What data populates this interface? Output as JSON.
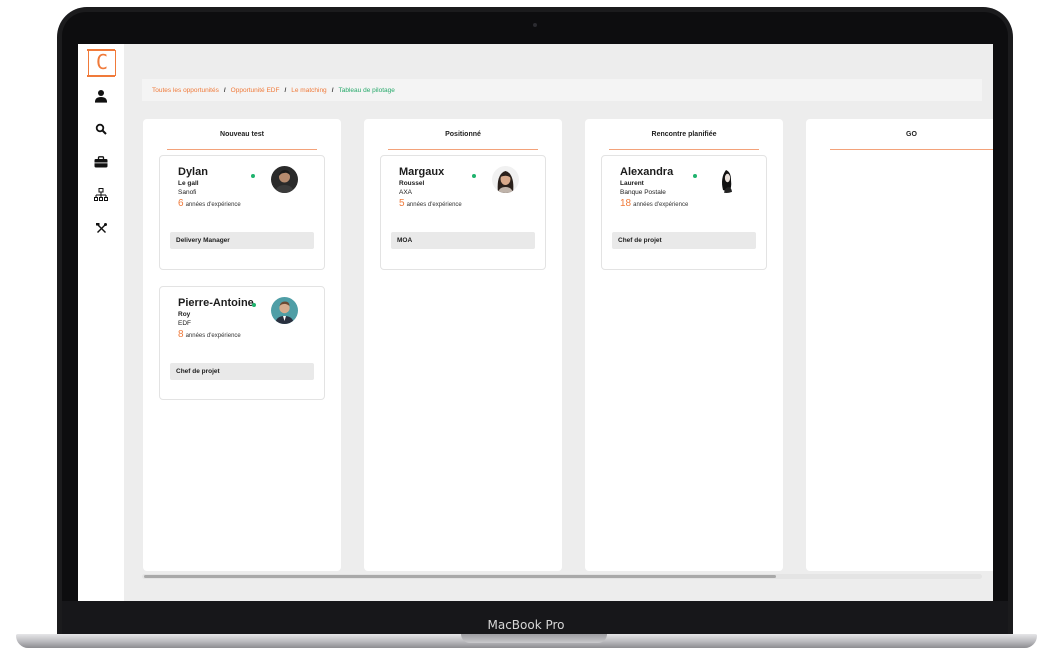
{
  "device": {
    "label": "MacBook Pro"
  },
  "app": {
    "logo_text": "C"
  },
  "sidebar": {
    "items": [
      {
        "icon": "user-icon"
      },
      {
        "icon": "search-icon"
      },
      {
        "icon": "briefcase-icon"
      },
      {
        "icon": "org-chart-icon"
      },
      {
        "icon": "tools-icon"
      }
    ]
  },
  "breadcrumb": {
    "items": [
      "Toutes les opportunités",
      "Opportunité EDF",
      "Le matching"
    ],
    "current": "Tableau de pilotage",
    "separator": "/"
  },
  "colors": {
    "accent": "#f07a3a",
    "success": "#27a96b",
    "status_dot": "#1fb36d"
  },
  "board": {
    "exp_label": "années d'expérience",
    "columns": [
      {
        "title": "Nouveau test",
        "cards": [
          {
            "first_name": "Dylan",
            "last_name": "Le gall",
            "company": "Sanofi",
            "years": "6",
            "role": "Delivery Manager"
          },
          {
            "first_name": "Pierre-Antoine",
            "last_name": "Roy",
            "company": "EDF",
            "years": "8",
            "role": "Chef de projet"
          }
        ]
      },
      {
        "title": "Positionné",
        "cards": [
          {
            "first_name": "Margaux",
            "last_name": "Roussel",
            "company": "AXA",
            "years": "5",
            "role": "MOA"
          }
        ]
      },
      {
        "title": "Rencontre planifiée",
        "cards": [
          {
            "first_name": "Alexandra",
            "last_name": "Laurent",
            "company": "Banque Postale",
            "years": "18",
            "role": "Chef de projet"
          }
        ]
      },
      {
        "title": "GO",
        "cards": []
      }
    ]
  }
}
